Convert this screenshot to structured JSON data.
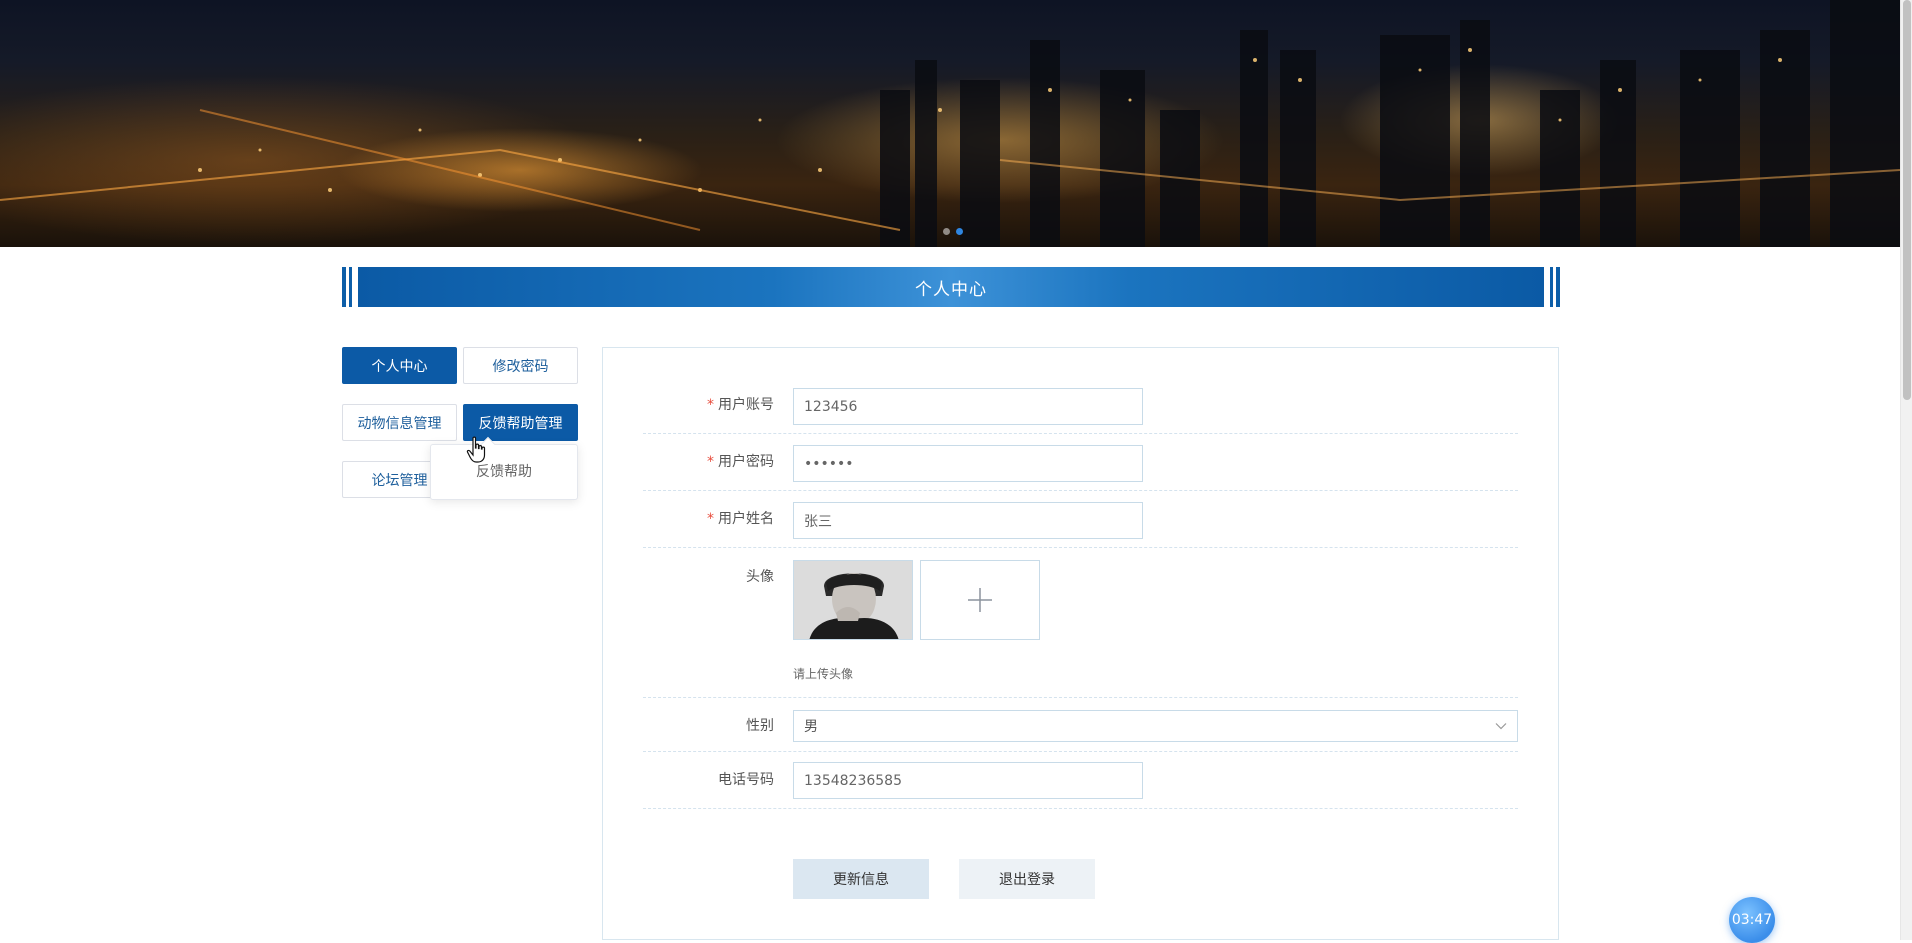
{
  "banner": {
    "slide_count": 2,
    "active_slide": 2
  },
  "title": "个人中心",
  "menu": {
    "items": [
      {
        "label": "个人中心",
        "active": true
      },
      {
        "label": "修改密码",
        "active": false
      },
      {
        "label": "动物信息管理",
        "active": false
      },
      {
        "label": "反馈帮助管理",
        "active": true
      },
      {
        "label": "论坛管理",
        "active": false
      }
    ],
    "dropdown": {
      "items": [
        "反馈帮助"
      ]
    }
  },
  "form": {
    "account": {
      "label": "用户账号",
      "value": "123456",
      "required": "*"
    },
    "password": {
      "label": "用户密码",
      "value": "••••••",
      "required": "*"
    },
    "name": {
      "label": "用户姓名",
      "value": "张三",
      "required": "*"
    },
    "avatar": {
      "label": "头像",
      "hint": "请上传头像"
    },
    "gender": {
      "label": "性别",
      "value": "男"
    },
    "phone": {
      "label": "电话号码",
      "value": "13548236585"
    }
  },
  "buttons": {
    "update": "更新信息",
    "logout": "退出登录"
  },
  "timer": "03:47",
  "colors": {
    "primary": "#0c5aa6",
    "required": "#e74c3c",
    "timer": "#3b8eea"
  }
}
